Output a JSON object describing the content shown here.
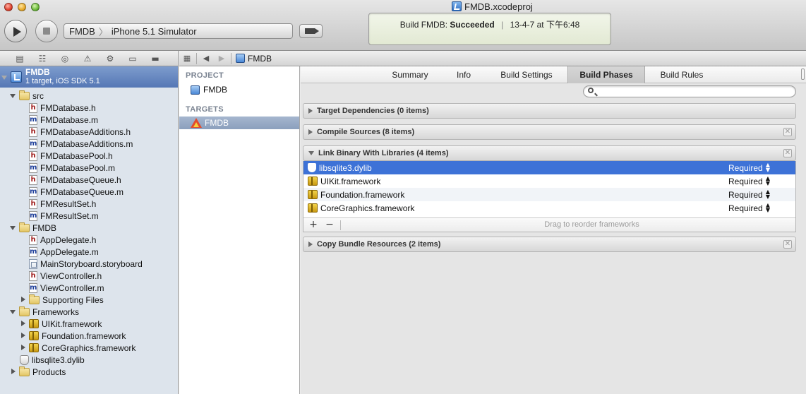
{
  "window": {
    "title": "FMDB.xcodeproj"
  },
  "toolbar": {
    "scheme": "FMDB",
    "destination": "iPhone 5.1 Simulator",
    "activity": {
      "prefix": "Build FMDB:",
      "status": "Succeeded",
      "separator": "|",
      "timestamp": "13-4-7 at 下午6:48"
    }
  },
  "navigator": {
    "project": {
      "name": "FMDB",
      "subtitle": "1 target, iOS SDK 5.1"
    },
    "items": [
      {
        "label": "src",
        "kind": "folder"
      },
      {
        "label": "FMDatabase.h",
        "kind": "h"
      },
      {
        "label": "FMDatabase.m",
        "kind": "m"
      },
      {
        "label": "FMDatabaseAdditions.h",
        "kind": "h"
      },
      {
        "label": "FMDatabaseAdditions.m",
        "kind": "m"
      },
      {
        "label": "FMDatabasePool.h",
        "kind": "h"
      },
      {
        "label": "FMDatabasePool.m",
        "kind": "m"
      },
      {
        "label": "FMDatabaseQueue.h",
        "kind": "h"
      },
      {
        "label": "FMDatabaseQueue.m",
        "kind": "m"
      },
      {
        "label": "FMResultSet.h",
        "kind": "h"
      },
      {
        "label": "FMResultSet.m",
        "kind": "m"
      },
      {
        "label": "FMDB",
        "kind": "folder"
      },
      {
        "label": "AppDelegate.h",
        "kind": "h"
      },
      {
        "label": "AppDelegate.m",
        "kind": "m"
      },
      {
        "label": "MainStoryboard.storyboard",
        "kind": "storyboard"
      },
      {
        "label": "ViewController.h",
        "kind": "h"
      },
      {
        "label": "ViewController.m",
        "kind": "m"
      },
      {
        "label": "Supporting Files",
        "kind": "folder"
      },
      {
        "label": "Frameworks",
        "kind": "folder"
      },
      {
        "label": "UIKit.framework",
        "kind": "framework"
      },
      {
        "label": "Foundation.framework",
        "kind": "framework"
      },
      {
        "label": "CoreGraphics.framework",
        "kind": "framework"
      },
      {
        "label": "libsqlite3.dylib",
        "kind": "dylib"
      },
      {
        "label": "Products",
        "kind": "folder"
      }
    ]
  },
  "jumpbar": {
    "crumb": "FMDB"
  },
  "project_list": {
    "project_header": "PROJECT",
    "project_item": "FMDB",
    "targets_header": "TARGETS",
    "target_item": "FMDB"
  },
  "editor": {
    "tabs": [
      "Summary",
      "Info",
      "Build Settings",
      "Build Phases",
      "Build Rules"
    ],
    "active_tab": "Build Phases",
    "phases": {
      "target_dependencies": "Target Dependencies (0 items)",
      "compile_sources": "Compile Sources (8 items)",
      "link_binary": "Link Binary With Libraries (4 items)",
      "copy_bundle": "Copy Bundle Resources (2 items)"
    },
    "libraries": [
      {
        "name": "libsqlite3.dylib",
        "status": "Required",
        "kind": "dylib",
        "selected": true
      },
      {
        "name": "UIKit.framework",
        "status": "Required",
        "kind": "framework"
      },
      {
        "name": "Foundation.framework",
        "status": "Required",
        "kind": "framework"
      },
      {
        "name": "CoreGraphics.framework",
        "status": "Required",
        "kind": "framework"
      }
    ],
    "link_footer": {
      "add": "+",
      "remove": "−",
      "hint": "Drag to reorder frameworks"
    }
  }
}
